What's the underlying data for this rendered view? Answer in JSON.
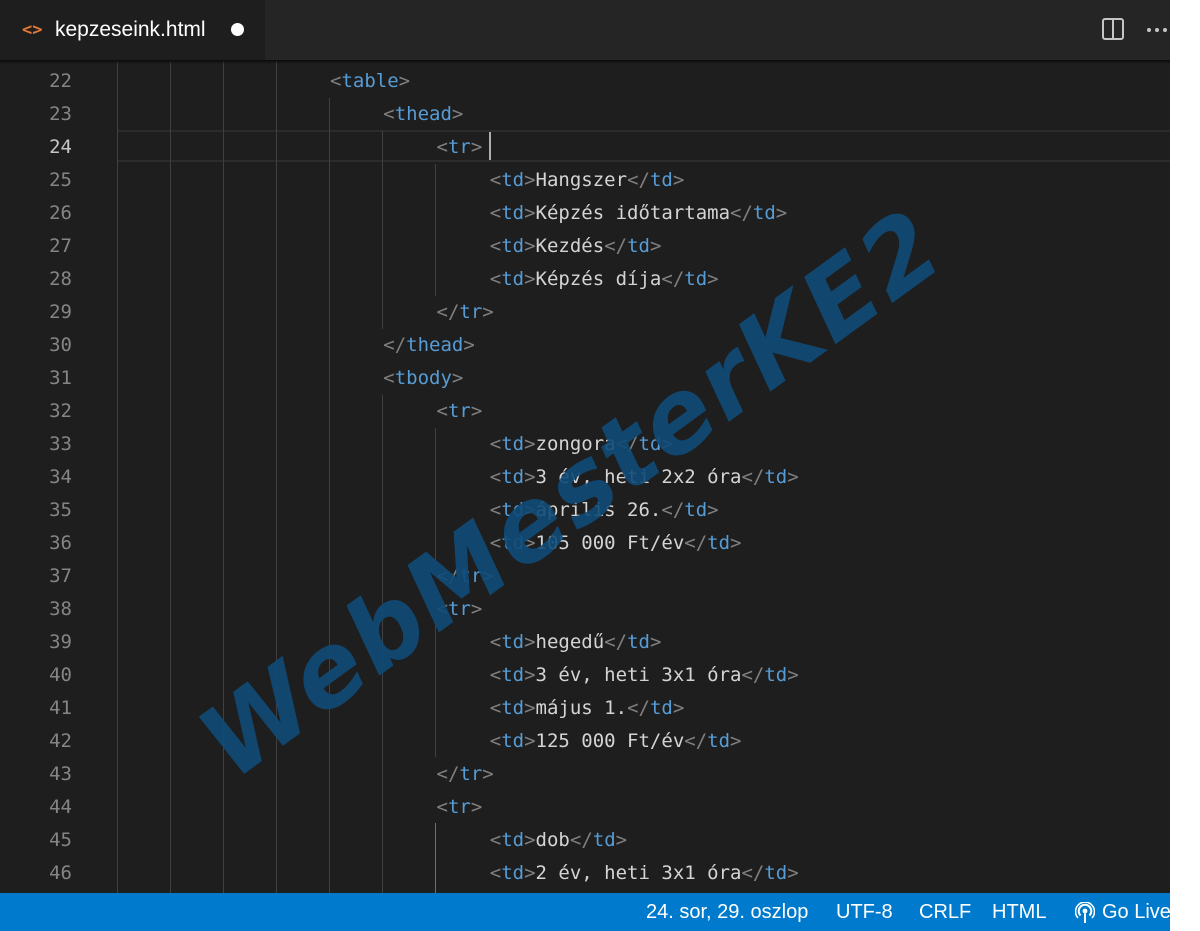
{
  "tab": {
    "icon": "code-file-icon",
    "icon_glyph": "<>",
    "filename": "kepzeseink.html",
    "unsaved": true
  },
  "toolbar": {
    "split_icon": "split-editor-icon",
    "more_label": "···"
  },
  "editor": {
    "current_line": 24,
    "lines": [
      {
        "n": "22",
        "tokens": [
          [
            "punc",
            "<"
          ],
          [
            "tag",
            "table"
          ],
          [
            "punc",
            ">"
          ]
        ]
      },
      {
        "n": "23",
        "tokens": [
          [
            "punc",
            "<"
          ],
          [
            "tag",
            "thead"
          ],
          [
            "punc",
            ">"
          ]
        ]
      },
      {
        "n": "24",
        "tokens": [
          [
            "punc",
            "<"
          ],
          [
            "tag",
            "tr"
          ],
          [
            "punc",
            ">"
          ]
        ]
      },
      {
        "n": "25",
        "tokens": [
          [
            "punc",
            "<"
          ],
          [
            "tag",
            "td"
          ],
          [
            "punc",
            ">"
          ],
          [
            "txt",
            "Hangszer"
          ],
          [
            "punc",
            "</"
          ],
          [
            "tag",
            "td"
          ],
          [
            "punc",
            ">"
          ]
        ]
      },
      {
        "n": "26",
        "tokens": [
          [
            "punc",
            "<"
          ],
          [
            "tag",
            "td"
          ],
          [
            "punc",
            ">"
          ],
          [
            "txt",
            "Képzés időtartama"
          ],
          [
            "punc",
            "</"
          ],
          [
            "tag",
            "td"
          ],
          [
            "punc",
            ">"
          ]
        ]
      },
      {
        "n": "27",
        "tokens": [
          [
            "punc",
            "<"
          ],
          [
            "tag",
            "td"
          ],
          [
            "punc",
            ">"
          ],
          [
            "txt",
            "Kezdés"
          ],
          [
            "punc",
            "</"
          ],
          [
            "tag",
            "td"
          ],
          [
            "punc",
            ">"
          ]
        ]
      },
      {
        "n": "28",
        "tokens": [
          [
            "punc",
            "<"
          ],
          [
            "tag",
            "td"
          ],
          [
            "punc",
            ">"
          ],
          [
            "txt",
            "Képzés díja"
          ],
          [
            "punc",
            "</"
          ],
          [
            "tag",
            "td"
          ],
          [
            "punc",
            ">"
          ]
        ]
      },
      {
        "n": "29",
        "tokens": [
          [
            "punc",
            "</"
          ],
          [
            "tag",
            "tr"
          ],
          [
            "punc",
            ">"
          ]
        ]
      },
      {
        "n": "30",
        "tokens": [
          [
            "punc",
            "</"
          ],
          [
            "tag",
            "thead"
          ],
          [
            "punc",
            ">"
          ]
        ]
      },
      {
        "n": "31",
        "tokens": [
          [
            "punc",
            "<"
          ],
          [
            "tag",
            "tbody"
          ],
          [
            "punc",
            ">"
          ]
        ]
      },
      {
        "n": "32",
        "tokens": [
          [
            "punc",
            "<"
          ],
          [
            "tag",
            "tr"
          ],
          [
            "punc",
            ">"
          ]
        ]
      },
      {
        "n": "33",
        "tokens": [
          [
            "punc",
            "<"
          ],
          [
            "tag",
            "td"
          ],
          [
            "punc",
            ">"
          ],
          [
            "txt",
            "zongora"
          ],
          [
            "punc",
            "</"
          ],
          [
            "tag",
            "td"
          ],
          [
            "punc",
            ">"
          ]
        ]
      },
      {
        "n": "34",
        "tokens": [
          [
            "punc",
            "<"
          ],
          [
            "tag",
            "td"
          ],
          [
            "punc",
            ">"
          ],
          [
            "txt",
            "3 év, heti 2x2 óra"
          ],
          [
            "punc",
            "</"
          ],
          [
            "tag",
            "td"
          ],
          [
            "punc",
            ">"
          ]
        ]
      },
      {
        "n": "35",
        "tokens": [
          [
            "punc",
            "<"
          ],
          [
            "tag",
            "td"
          ],
          [
            "punc",
            ">"
          ],
          [
            "txt",
            "április 26."
          ],
          [
            "punc",
            "</"
          ],
          [
            "tag",
            "td"
          ],
          [
            "punc",
            ">"
          ]
        ]
      },
      {
        "n": "36",
        "tokens": [
          [
            "punc",
            "<"
          ],
          [
            "tag",
            "td"
          ],
          [
            "punc",
            ">"
          ],
          [
            "txt",
            "105 000 Ft/év"
          ],
          [
            "punc",
            "</"
          ],
          [
            "tag",
            "td"
          ],
          [
            "punc",
            ">"
          ]
        ]
      },
      {
        "n": "37",
        "tokens": [
          [
            "punc",
            "</"
          ],
          [
            "tag",
            "tr"
          ],
          [
            "punc",
            ">"
          ]
        ]
      },
      {
        "n": "38",
        "tokens": [
          [
            "punc",
            "<"
          ],
          [
            "tag",
            "tr"
          ],
          [
            "punc",
            ">"
          ]
        ]
      },
      {
        "n": "39",
        "tokens": [
          [
            "punc",
            "<"
          ],
          [
            "tag",
            "td"
          ],
          [
            "punc",
            ">"
          ],
          [
            "txt",
            "hegedű"
          ],
          [
            "punc",
            "</"
          ],
          [
            "tag",
            "td"
          ],
          [
            "punc",
            ">"
          ]
        ]
      },
      {
        "n": "40",
        "tokens": [
          [
            "punc",
            "<"
          ],
          [
            "tag",
            "td"
          ],
          [
            "punc",
            ">"
          ],
          [
            "txt",
            "3 év, heti 3x1 óra"
          ],
          [
            "punc",
            "</"
          ],
          [
            "tag",
            "td"
          ],
          [
            "punc",
            ">"
          ]
        ]
      },
      {
        "n": "41",
        "tokens": [
          [
            "punc",
            "<"
          ],
          [
            "tag",
            "td"
          ],
          [
            "punc",
            ">"
          ],
          [
            "txt",
            "május 1."
          ],
          [
            "punc",
            "</"
          ],
          [
            "tag",
            "td"
          ],
          [
            "punc",
            ">"
          ]
        ]
      },
      {
        "n": "42",
        "tokens": [
          [
            "punc",
            "<"
          ],
          [
            "tag",
            "td"
          ],
          [
            "punc",
            ">"
          ],
          [
            "txt",
            "125 000 Ft/év"
          ],
          [
            "punc",
            "</"
          ],
          [
            "tag",
            "td"
          ],
          [
            "punc",
            ">"
          ]
        ]
      },
      {
        "n": "43",
        "tokens": [
          [
            "punc",
            "</"
          ],
          [
            "tag",
            "tr"
          ],
          [
            "punc",
            ">"
          ]
        ]
      },
      {
        "n": "44",
        "tokens": [
          [
            "punc",
            "<"
          ],
          [
            "tag",
            "tr"
          ],
          [
            "punc",
            ">"
          ]
        ]
      },
      {
        "n": "45",
        "tokens": [
          [
            "punc",
            "<"
          ],
          [
            "tag",
            "td"
          ],
          [
            "punc",
            ">"
          ],
          [
            "txt",
            "dob"
          ],
          [
            "punc",
            "</"
          ],
          [
            "tag",
            "td"
          ],
          [
            "punc",
            ">"
          ]
        ]
      },
      {
        "n": "46",
        "tokens": [
          [
            "punc",
            "<"
          ],
          [
            "tag",
            "td"
          ],
          [
            "punc",
            ">"
          ],
          [
            "txt",
            "2 év, heti 3x1 óra"
          ],
          [
            "punc",
            "</"
          ],
          [
            "tag",
            "td"
          ],
          [
            "punc",
            ">"
          ]
        ]
      }
    ]
  },
  "watermark": {
    "text": "WebMesterKE2"
  },
  "statusbar": {
    "cursor_position": "24. sor, 29. oszlop",
    "encoding": "UTF-8",
    "line_ending": "CRLF",
    "language": "HTML",
    "go_live": "Go Live",
    "go_live_icon": "broadcast-icon"
  },
  "colors": {
    "editor_bg": "#1e1e1e",
    "tab_bar_bg": "#252526",
    "status_bar_bg": "#007acc",
    "tag": "#569cd6",
    "punctuation": "#808080",
    "text": "#d4d4d4",
    "line_number": "#858585",
    "watermark": "#0f4a78",
    "file_icon": "#e37933"
  }
}
